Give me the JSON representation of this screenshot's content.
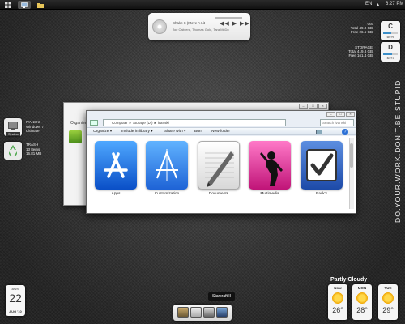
{
  "topbar": {
    "lang": "EN",
    "clock": "6:27 PM",
    "buttons": [
      "start-orb",
      "show-desktop",
      "explorer"
    ]
  },
  "media": {
    "line1": "Shake It (Move A Lit",
    "line2": "Joe Cabrera, Thomas Gold, Tara McDo"
  },
  "disks": [
    {
      "label": "OS",
      "total": "Total 49.0 GB",
      "free": "Free 26.5 GB",
      "letter": "C",
      "pct_text": "54%",
      "pct": 54
    },
    {
      "label": "STORAGE",
      "total": "Total 419.8 GB",
      "free": "Free 161.4 GB",
      "letter": "D",
      "pct_text": "61%",
      "pct": 61
    }
  ],
  "side_text": "DO.YOUR.WORK.DON'T.BE.STUPID.",
  "left_icons": {
    "system": {
      "tag": "System",
      "line1": "IVANSKI",
      "line2": "Windows 7",
      "line3": "Ultimate"
    },
    "trash": {
      "line1": "TRASH",
      "line2": "13 Items",
      "line3": "16.81 MB"
    }
  },
  "back_window": {
    "organize": "Organize"
  },
  "explorer": {
    "breadcrumb": [
      "Computer",
      "Storage (D:)",
      "ivanski"
    ],
    "search_placeholder": "Search ivanski",
    "toolbar": {
      "organize": "Organize ▾",
      "include": "Include in library ▾",
      "share": "Share with ▾",
      "burn": "Burn",
      "new_folder": "New folder"
    },
    "folders": [
      {
        "label": "Apps",
        "icon": "app-store-icon"
      },
      {
        "label": "Customization",
        "icon": "xcode-icon"
      },
      {
        "label": "Documents",
        "icon": "pages-icon"
      },
      {
        "label": "Multimedia",
        "icon": "music-icon"
      },
      {
        "label": "Pack's",
        "icon": "checkbox-icon"
      }
    ]
  },
  "calendar": {
    "day": "SUN",
    "date": "22",
    "month": "AUG '10"
  },
  "weather": {
    "title": "Partly Cloudy",
    "days": [
      {
        "day": "Now",
        "temp": "26°"
      },
      {
        "day": "MON",
        "temp": "28°"
      },
      {
        "day": "TUE",
        "temp": "29°"
      }
    ]
  },
  "dock": {
    "tooltip": "Starcraft II"
  }
}
